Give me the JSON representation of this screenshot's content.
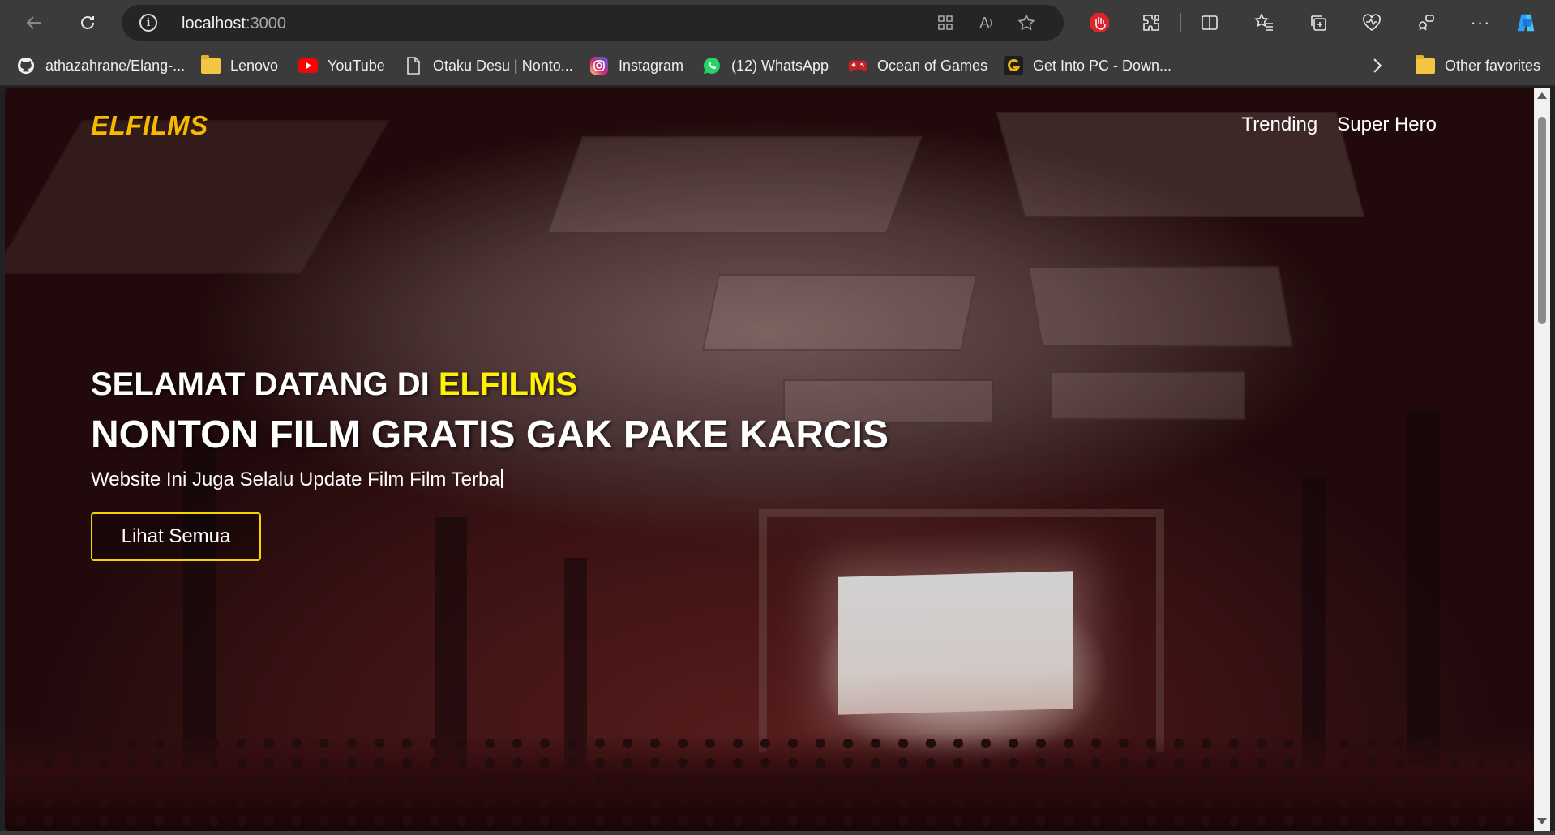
{
  "browser": {
    "url_host": "localhost",
    "url_port": ":3000",
    "bookmarks": [
      {
        "label": "athazahrane/Elang-...",
        "icon": "github-icon"
      },
      {
        "label": "Lenovo",
        "icon": "folder-icon"
      },
      {
        "label": "YouTube",
        "icon": "youtube-icon"
      },
      {
        "label": "Otaku Desu | Nonto...",
        "icon": "page-icon"
      },
      {
        "label": "Instagram",
        "icon": "instagram-icon"
      },
      {
        "label": "(12) WhatsApp",
        "icon": "whatsapp-icon"
      },
      {
        "label": "Ocean of Games",
        "icon": "gamepad-icon"
      },
      {
        "label": "Get Into PC - Down...",
        "icon": "getintopc-icon"
      }
    ],
    "other_favorites": "Other favorites",
    "colors": {
      "chrome": "#3b3b3b",
      "address_bar": "#252525"
    }
  },
  "site": {
    "logo": "ELFILMS",
    "nav": [
      {
        "label": "Trending"
      },
      {
        "label": "Super Hero"
      }
    ],
    "hero": {
      "welcome_prefix": "SELAMAT DATANG DI ",
      "welcome_brand": "ELFILMS",
      "tagline": "NONTON FILM GRATIS GAK PAKE KARCIS",
      "typing_text": "Website Ini Juga Selalu Update Film Film Terba",
      "cta_label": "Lihat Semua"
    },
    "colors": {
      "logo": "#f6b800",
      "brand_highlight": "#fff200",
      "cta_border": "#f6d400"
    }
  }
}
